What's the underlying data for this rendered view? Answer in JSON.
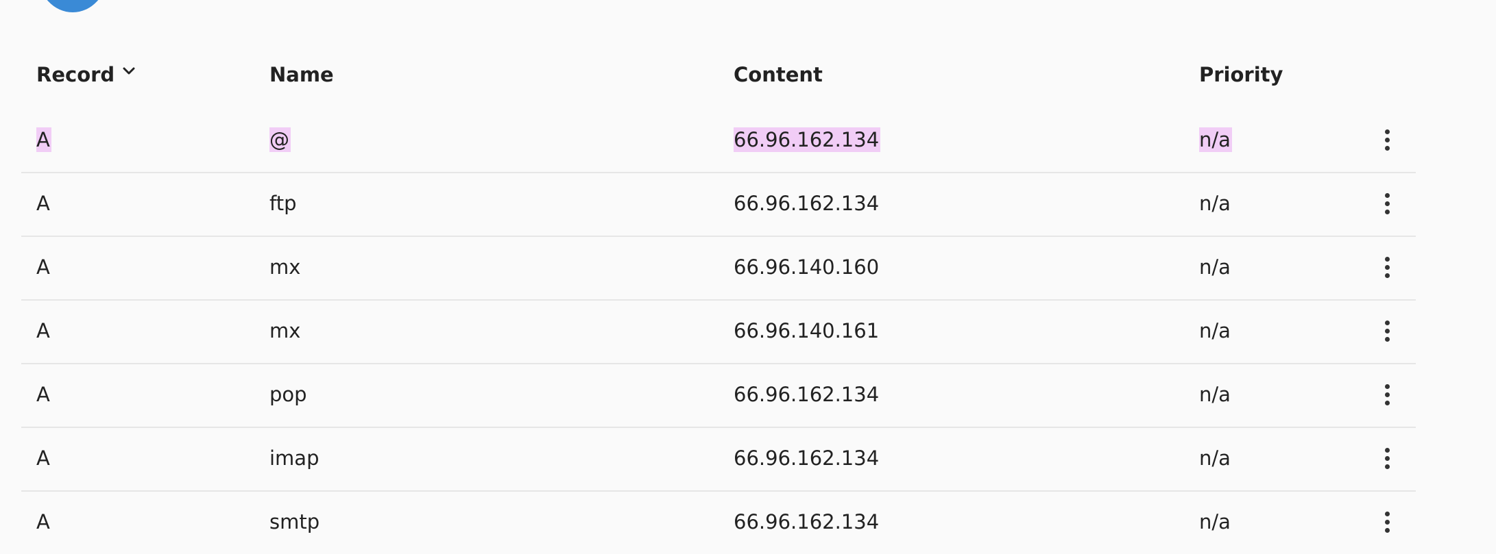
{
  "table": {
    "headers": {
      "record": "Record",
      "name": "Name",
      "content": "Content",
      "priority": "Priority"
    },
    "sort_icon": "chevron-down-icon",
    "row_menu_icon": "kebab-menu-icon",
    "highlight_color": "#f1cdf6",
    "rows": [
      {
        "record": "A",
        "name": "@",
        "content": "66.96.162.134",
        "priority": "n/a"
      },
      {
        "record": "A",
        "name": "ftp",
        "content": "66.96.162.134",
        "priority": "n/a"
      },
      {
        "record": "A",
        "name": "mx",
        "content": "66.96.140.160",
        "priority": "n/a"
      },
      {
        "record": "A",
        "name": "mx",
        "content": "66.96.140.161",
        "priority": "n/a"
      },
      {
        "record": "A",
        "name": "pop",
        "content": "66.96.162.134",
        "priority": "n/a"
      },
      {
        "record": "A",
        "name": "imap",
        "content": "66.96.162.134",
        "priority": "n/a"
      },
      {
        "record": "A",
        "name": "smtp",
        "content": "66.96.162.134",
        "priority": "n/a"
      }
    ]
  }
}
